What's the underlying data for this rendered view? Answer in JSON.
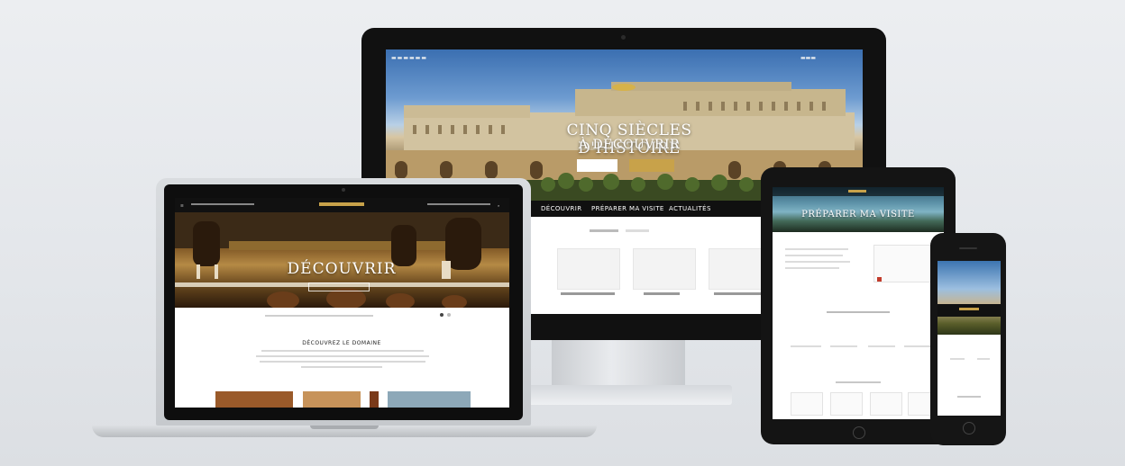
{
  "monitor": {
    "hero_title_line1": "CINQ SIÈCLES D'HISTOIRE",
    "hero_title_line2": "À DÉCOUVRIR",
    "nav": [
      "DÉCOUVRIR",
      "PRÉPARER MA VISITE",
      "ACTUALITÉS"
    ]
  },
  "laptop": {
    "hero_title": "DÉCOUVRIR",
    "section_heading": "DÉCOUVREZ LE DOMAINE"
  },
  "tablet": {
    "hero_title": "PRÉPARER MA VISITE"
  },
  "colors": {
    "gold_accent": "#c8a24a",
    "device_black": "#111111",
    "background": "#e6e8eb"
  }
}
